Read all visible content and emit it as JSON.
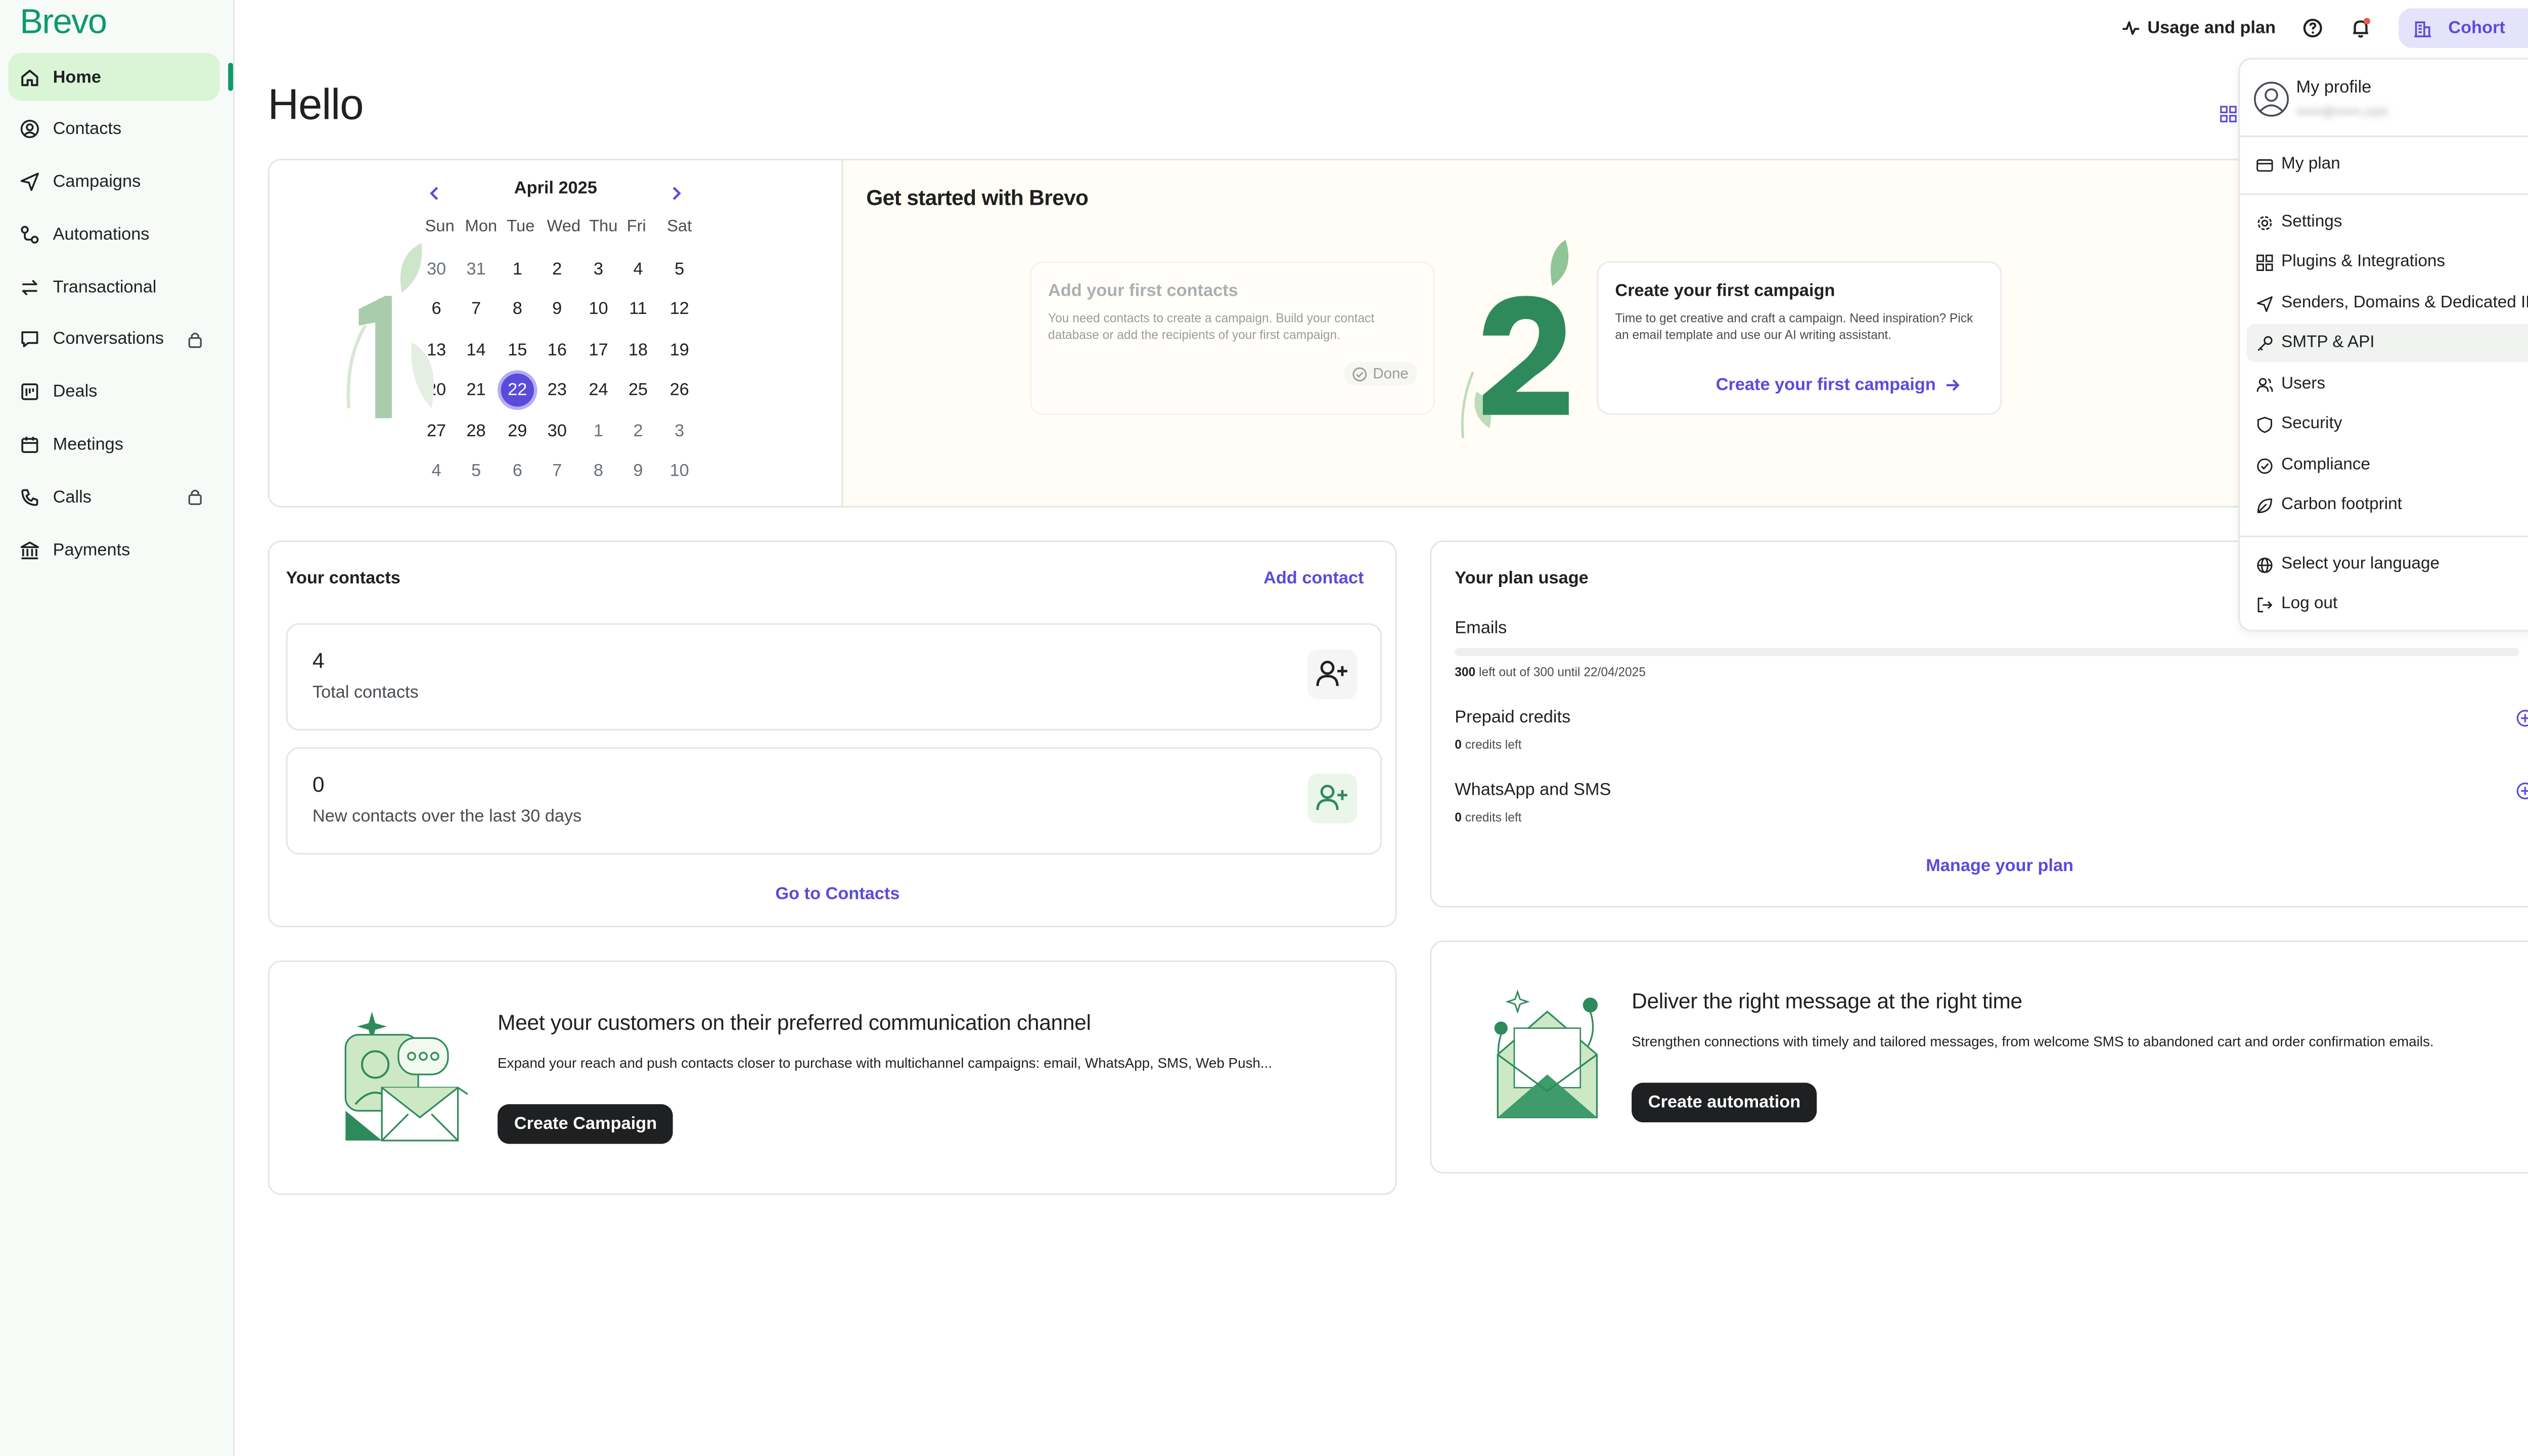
{
  "brand": {
    "logo": "Brevo"
  },
  "sidebar": {
    "items": [
      {
        "label": "Home",
        "icon": "home-icon",
        "active": true
      },
      {
        "label": "Contacts",
        "icon": "contacts-icon"
      },
      {
        "label": "Campaigns",
        "icon": "send-icon"
      },
      {
        "label": "Automations",
        "icon": "automation-icon"
      },
      {
        "label": "Transactional",
        "icon": "transactional-icon"
      },
      {
        "label": "Conversations",
        "icon": "chat-icon",
        "locked": true
      },
      {
        "label": "Deals",
        "icon": "deals-icon"
      },
      {
        "label": "Meetings",
        "icon": "calendar-icon"
      },
      {
        "label": "Calls",
        "icon": "phone-icon",
        "locked": true
      },
      {
        "label": "Payments",
        "icon": "bank-icon"
      }
    ]
  },
  "topbar": {
    "usage_label": "Usage and plan",
    "account_label": "Cohort"
  },
  "page": {
    "greeting": "Hello"
  },
  "calendar": {
    "month": "April 2025",
    "weekdays": [
      "Sun",
      "Mon",
      "Tue",
      "Wed",
      "Thu",
      "Fri",
      "Sat"
    ],
    "weeks": [
      [
        "30",
        "31",
        "1",
        "2",
        "3",
        "4",
        "5"
      ],
      [
        "6",
        "7",
        "8",
        "9",
        "10",
        "11",
        "12"
      ],
      [
        "13",
        "14",
        "15",
        "16",
        "17",
        "18",
        "19"
      ],
      [
        "20",
        "21",
        "22",
        "23",
        "24",
        "25",
        "26"
      ],
      [
        "27",
        "28",
        "29",
        "30",
        "1",
        "2",
        "3"
      ],
      [
        "4",
        "5",
        "6",
        "7",
        "8",
        "9",
        "10"
      ]
    ],
    "selected": "22"
  },
  "getting_started": {
    "title": "Get started with Brevo",
    "step1": {
      "number": "1",
      "title": "Add your first contacts",
      "desc": "You need contacts to create a campaign. Build your contact database or add the recipients of your first campaign.",
      "status": "Done"
    },
    "step2": {
      "number": "2",
      "title": "Create your first campaign",
      "desc": "Time to get creative and craft a campaign. Need inspiration? Pick an email template and use our AI writing assistant.",
      "cta": "Create your first campaign"
    }
  },
  "contacts": {
    "title": "Your contacts",
    "add_label": "Add contact",
    "total_value": "4",
    "total_label": "Total contacts",
    "new_value": "0",
    "new_label": "New contacts over the last 30 days",
    "go_label": "Go to Contacts"
  },
  "plan_usage": {
    "title": "Your plan usage",
    "emails_label": "Emails",
    "emails_left": "300",
    "emails_rest": "left out of 300 until 22/04/2025",
    "emails_used_fraction": 0,
    "prepaid_label": "Prepaid credits",
    "prepaid_left": "0",
    "prepaid_rest": "credits left",
    "wa_label": "WhatsApp and SMS",
    "wa_left": "0",
    "wa_rest": "credits left",
    "manage_label": "Manage your plan"
  },
  "promo_channel": {
    "title": "Meet your customers on their preferred communication channel",
    "desc": "Expand your reach and push contacts closer to purchase with multichannel campaigns: email, WhatsApp, SMS, Web Push...",
    "button": "Create Campaign"
  },
  "promo_timing": {
    "title": "Deliver the right message at the right time",
    "desc": "Strengthen connections with timely and tailored messages, from welcome SMS to abandoned cart and order confirmation emails.",
    "button": "Create automation"
  },
  "account_menu": {
    "profile_label": "My profile",
    "profile_email": "••••••@••••••.com",
    "plan_label": "My plan",
    "items": [
      {
        "label": "Settings",
        "icon": "gear-icon"
      },
      {
        "label": "Plugins & Integrations",
        "icon": "grid-icon"
      },
      {
        "label": "Senders, Domains & Dedicated IPs",
        "icon": "send-icon"
      },
      {
        "label": "SMTP & API",
        "icon": "key-icon"
      },
      {
        "label": "Users",
        "icon": "users-icon"
      },
      {
        "label": "Security",
        "icon": "shield-icon"
      },
      {
        "label": "Compliance",
        "icon": "check-circle-icon"
      },
      {
        "label": "Carbon footprint",
        "icon": "leaf-icon"
      }
    ],
    "language_label": "Select your language",
    "logout_label": "Log out"
  },
  "colors": {
    "brand_green": "#0b996e",
    "accent_purple": "#5b4bdb",
    "active_nav_bg": "#daf5d6"
  }
}
